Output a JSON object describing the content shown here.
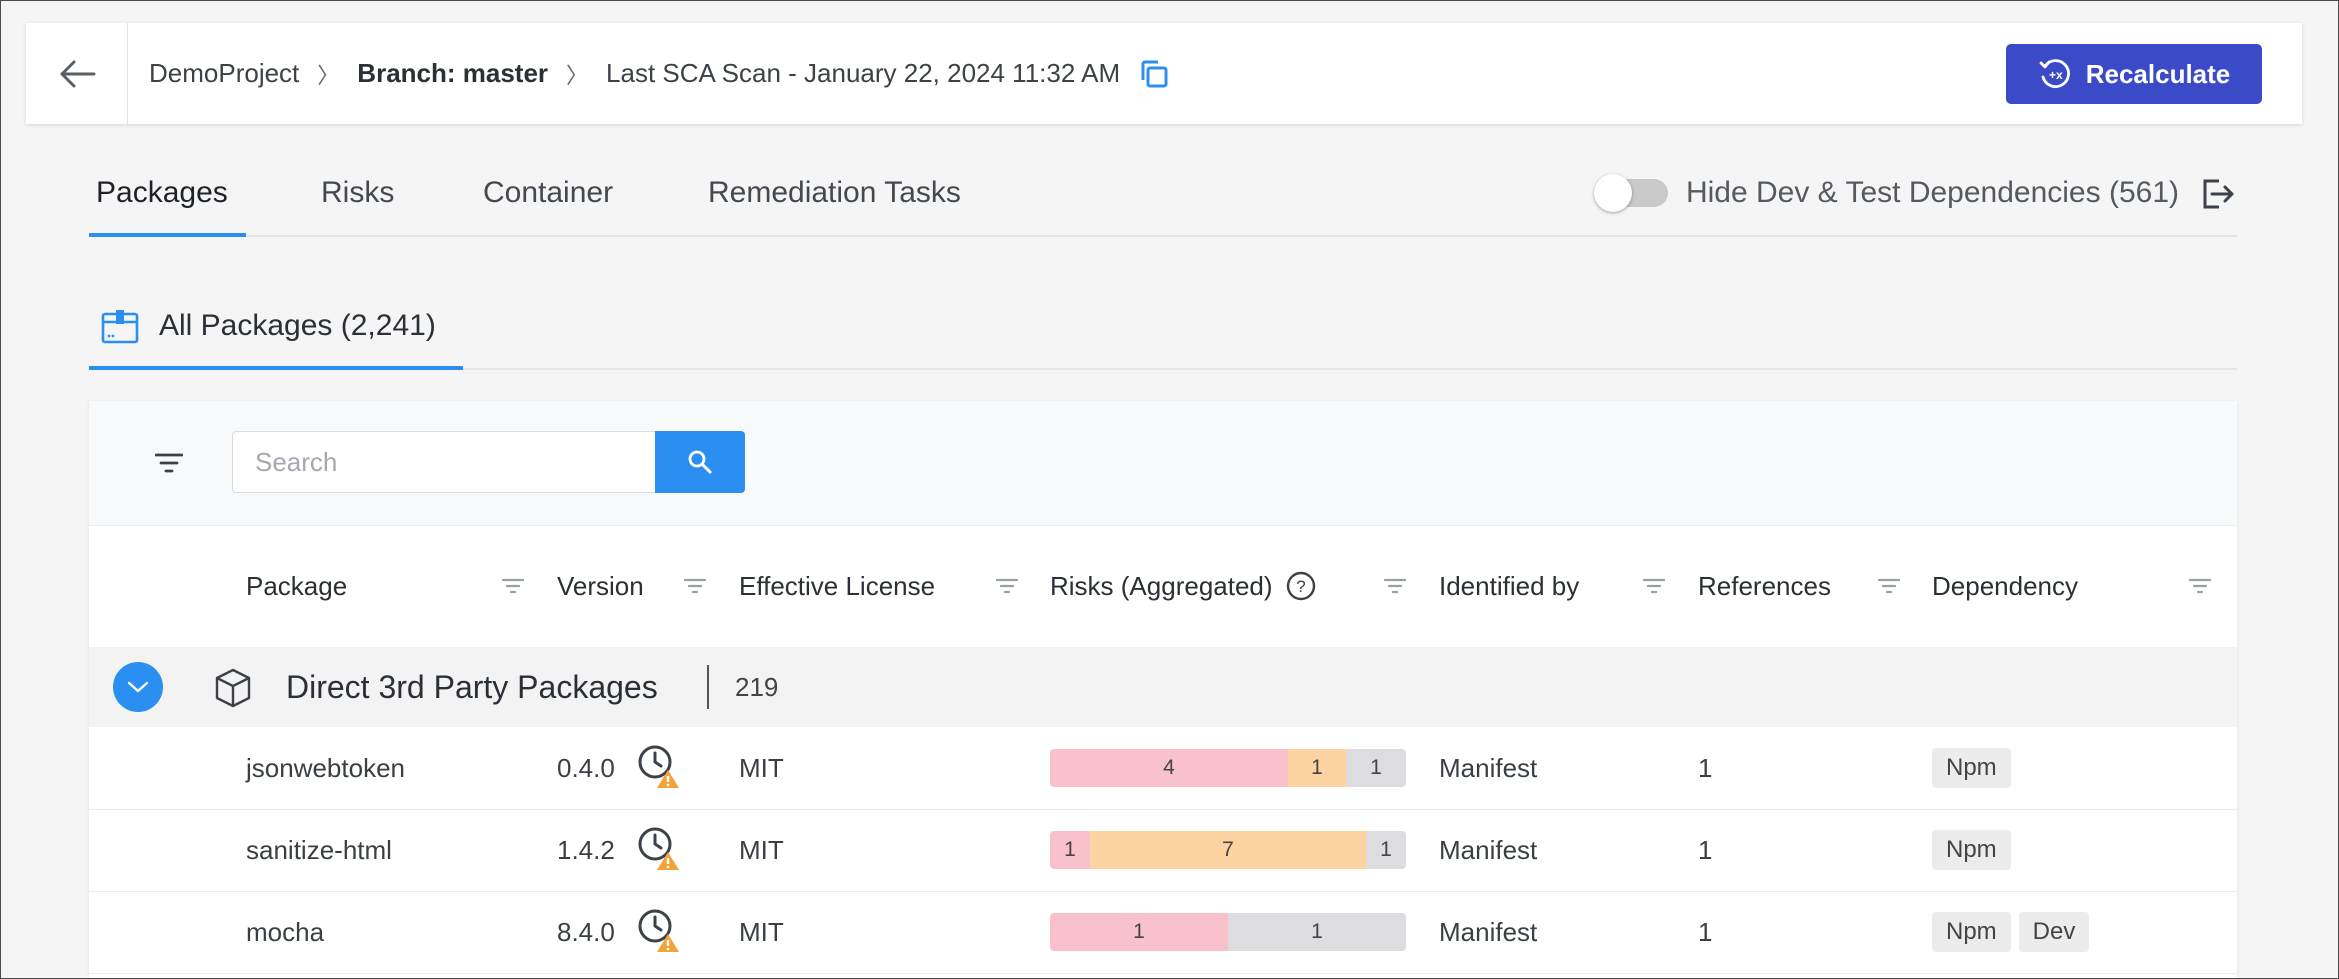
{
  "header": {
    "back_icon": "arrow-left-icon",
    "breadcrumbs": {
      "project": "DemoProject",
      "branch": "Branch: master",
      "scan": "Last SCA Scan - January 22, 2024 11:32 AM"
    },
    "copy_icon": "copy-icon",
    "recalculate_label": "Recalculate",
    "recalculate_icon": "recalculate-icon"
  },
  "tabs": [
    {
      "label": "Packages",
      "active": true
    },
    {
      "label": "Risks",
      "active": false
    },
    {
      "label": "Container",
      "active": false
    },
    {
      "label": "Remediation Tasks",
      "active": false
    }
  ],
  "hide_dev_toggle": {
    "label": "Hide Dev & Test Dependencies (561)",
    "on": false,
    "export_icon": "export-icon"
  },
  "subtab": {
    "label": "All Packages (2,241)",
    "icon": "package-box-icon"
  },
  "search": {
    "placeholder": "Search",
    "value": ""
  },
  "columns": [
    "Package",
    "Version",
    "Effective License",
    "Risks (Aggregated)",
    "Identified by",
    "References",
    "Dependency"
  ],
  "group": {
    "title": "Direct 3rd Party Packages",
    "count": "219"
  },
  "rows": [
    {
      "package": "jsonwebtoken",
      "version": "0.4.0",
      "license": "MIT",
      "risks": {
        "high": "4",
        "medium": "1",
        "low": "1"
      },
      "identified_by": "Manifest",
      "references": "1",
      "dependency": [
        "Npm"
      ]
    },
    {
      "package": "sanitize-html",
      "version": "1.4.2",
      "license": "MIT",
      "risks": {
        "high": "1",
        "medium": "7",
        "low": "1"
      },
      "identified_by": "Manifest",
      "references": "1",
      "dependency": [
        "Npm"
      ]
    },
    {
      "package": "mocha",
      "version": "8.4.0",
      "license": "MIT",
      "risks": {
        "high": "1",
        "medium": "",
        "low": "1"
      },
      "identified_by": "Manifest",
      "references": "1",
      "dependency": [
        "Npm",
        "Dev"
      ]
    }
  ],
  "colors": {
    "accent": "#2a8ff0",
    "primary_button": "#3b4bc8",
    "risk_high": "#f9c1cc",
    "risk_medium": "#fdd3a1",
    "risk_low": "#dddde0"
  }
}
